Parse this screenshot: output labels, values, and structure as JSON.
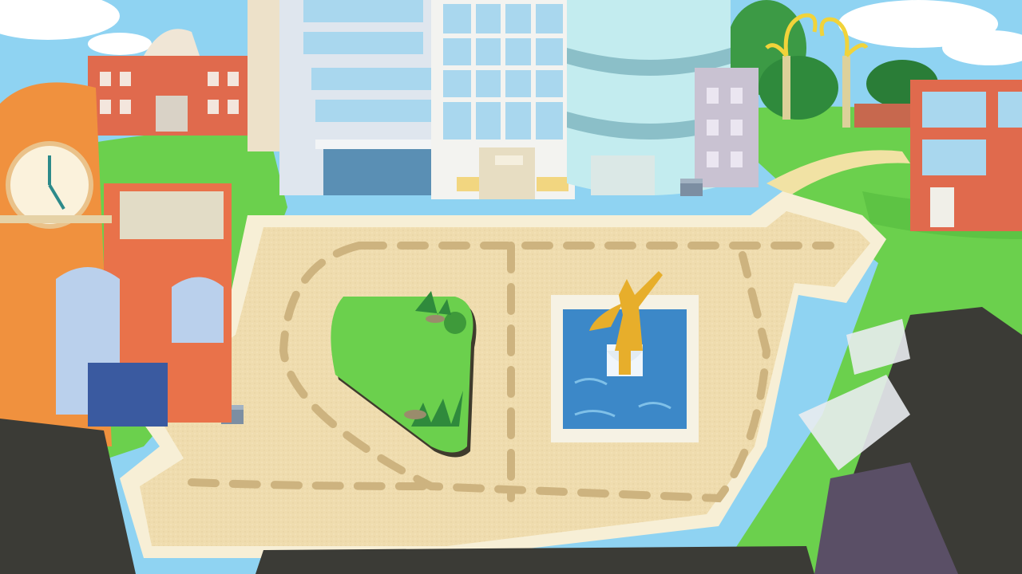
{
  "scene": {
    "kind": "illustrated town plaza, top-down game map",
    "palette": {
      "sky": "#8fd3f2",
      "cloud": "#ffffff",
      "grass": "#6bd04d",
      "grass_dark": "#4fb53c",
      "plaza_sand": "#efdcae",
      "plaza_border": "#f7efd6",
      "path_dash": "#cdb37f",
      "fountain_water": "#3c88c8",
      "fountain_rim": "#f6f2e4",
      "statue_gold": "#e7ae2b",
      "clock_tower": "#f0913e",
      "clock_face": "#fbf2dc",
      "brick_red": "#e06a4d",
      "glass_blue": "#a9d7ee",
      "glass_cyan": "#c3ecef",
      "gate_gold": "#f1d33a",
      "shadow_dark": "#3b3b36"
    },
    "landmarks": [
      {
        "id": "clock-tower",
        "type": "building"
      },
      {
        "id": "town-hall",
        "type": "building"
      },
      {
        "id": "office-tower-left",
        "type": "building"
      },
      {
        "id": "office-tower-center",
        "type": "building"
      },
      {
        "id": "glass-cylinder-tower",
        "type": "building"
      },
      {
        "id": "small-grey-building",
        "type": "building"
      },
      {
        "id": "brick-apartment-right",
        "type": "building"
      },
      {
        "id": "golden-gate",
        "type": "decoration"
      },
      {
        "id": "fountain-statue",
        "type": "monument"
      },
      {
        "id": "grass-island",
        "type": "garden"
      },
      {
        "id": "trash-bin-left",
        "type": "prop"
      },
      {
        "id": "trash-bin-right",
        "type": "prop"
      }
    ]
  }
}
